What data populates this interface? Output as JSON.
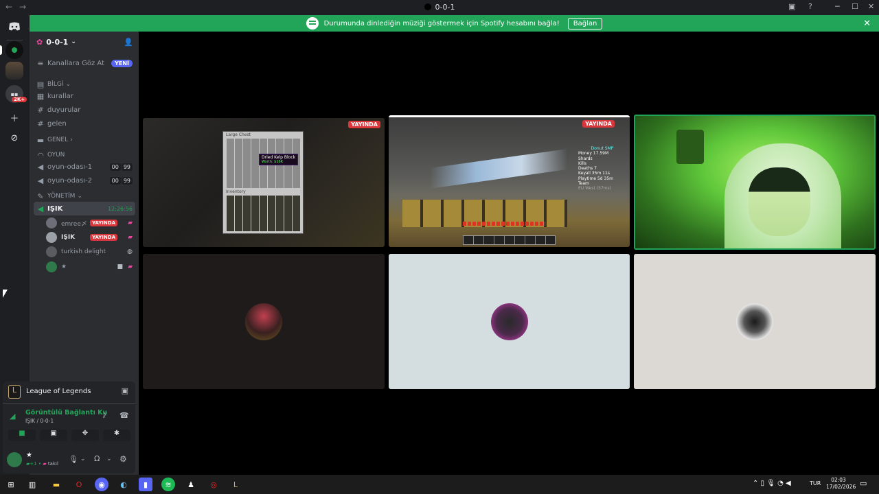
{
  "window": {
    "title": "0-0-1"
  },
  "banner": {
    "text": "Durumunda dinlediğin müziği göstermek için Spotify hesabını bağla!",
    "button": "Bağlan"
  },
  "guilds": {
    "badge": "2K+"
  },
  "server": {
    "name": "0-0-1",
    "browse": "Kanallara Göz At",
    "new_badge": "YENİ"
  },
  "categories": {
    "bilgi": "BİLGİ",
    "genel": "GENEL",
    "oyun": "OYUN",
    "yonetim": "YÖNETİM"
  },
  "channels": {
    "kurallar": "kurallar",
    "duyurular": "duyurular",
    "gelen": "gelen",
    "voice1": {
      "name": "oyun-odası-1",
      "a": "00",
      "b": "99"
    },
    "voice2": {
      "name": "oyun-odası-2",
      "a": "00",
      "b": "99"
    },
    "active": {
      "name": "IŞIK",
      "time": "12:26:56"
    }
  },
  "voice_users": [
    {
      "name": "emree〆",
      "badge": "YAYINDA"
    },
    {
      "name": "IŞIK",
      "badge": "YAYINDA"
    },
    {
      "name": "turkish delight"
    },
    {
      "name": "★"
    }
  ],
  "activity": {
    "game": "League of Legends"
  },
  "connection": {
    "status": "Görüntülü Bağlantı Ku",
    "channel": "IŞIK / 0-0-1"
  },
  "me": {
    "name": "★",
    "status": "takıl"
  },
  "tiles": {
    "live_label": "YAYINDA"
  },
  "game_hud": {
    "chest_title": "Large Chest",
    "inventory": "Inventory",
    "tooltip_title": "Dried Kelp Block",
    "tooltip_worth": "Worth: $16K",
    "scoreboard": [
      "Donut SMP",
      "Money 17.59M",
      "Shards",
      "Kills",
      "Deaths 7",
      "Keyall 35m 11s",
      "Playtime 5d 35m",
      "Team",
      "EU West (57ms)"
    ]
  },
  "taskbar": {
    "lang": "TUR",
    "time": "02:03",
    "date": "17/02/2026"
  },
  "colors": {
    "green": "#23a559",
    "live": "#da373c",
    "blurple": "#5865f2"
  }
}
